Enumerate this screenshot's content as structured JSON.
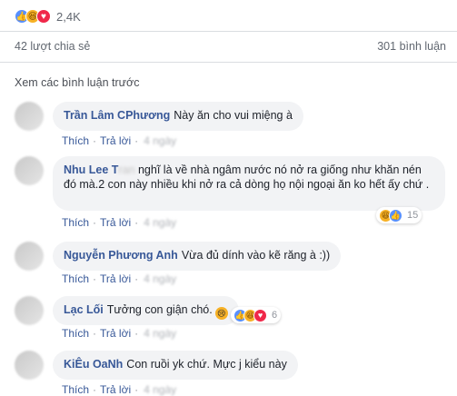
{
  "reactions_summary": {
    "count": "2,4K",
    "icons": [
      "like-icon",
      "haha-icon",
      "love-icon"
    ]
  },
  "shares": "42 lượt chia sẻ",
  "comments_count": "301 bình luận",
  "view_previous": "Xem các bình luận trước",
  "action_like": "Thích",
  "action_reply": "Trả lời",
  "action_time": "4 ngày",
  "comments": [
    {
      "author": "Trần Lâm CPhương",
      "author_hidden": "",
      "text": "Này ăn cho vui miệng à"
    },
    {
      "author": "Nhu Lee T",
      "author_hidden": "ran",
      "text": "nghĩ là về nhà ngâm nước nó nở ra giống như khăn nén đó mà.2 con này nhiều khi nở ra cả dòng họ nội ngoại ăn ko hết ấy chứ .",
      "reactions": "15"
    },
    {
      "author": "Nguyễn Phương Anh",
      "author_hidden": "",
      "text": "Vừa đủ dính vào kẽ răng à :))"
    },
    {
      "author": "Lạc Lối",
      "author_hidden": "",
      "text": "Tưởng con giận chó.",
      "reactions": "6"
    },
    {
      "author": "KiÊu OaNh",
      "author_hidden": "",
      "text": "Con ruồi yk chứ. Mực j kiểu này"
    }
  ],
  "colors": {
    "link": "#385898",
    "bubble": "#f2f3f5",
    "like": "#5890ff",
    "haha": "#f7b125",
    "love": "#f0284a"
  }
}
